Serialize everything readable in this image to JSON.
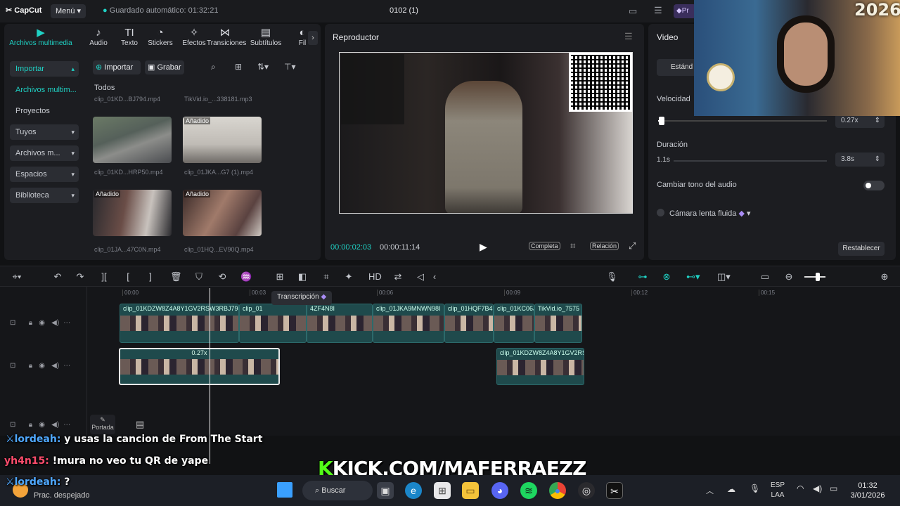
{
  "app": {
    "logo": "CapCut",
    "menu": "Menú",
    "autosave": "Guardado automático: 01:32:21",
    "project": "0102 (1)",
    "pro": "Pr"
  },
  "tabs": [
    {
      "label": "Archivos multimedia",
      "icon": "media-icon",
      "glyph": "▶"
    },
    {
      "label": "Audio",
      "icon": "audio-icon",
      "glyph": "♪"
    },
    {
      "label": "Texto",
      "icon": "text-icon",
      "glyph": "TI"
    },
    {
      "label": "Stickers",
      "icon": "sticker-icon",
      "glyph": "◔"
    },
    {
      "label": "Efectos",
      "icon": "effects-icon",
      "glyph": "✧"
    },
    {
      "label": "Transiciones",
      "icon": "transition-icon",
      "glyph": "⋈"
    },
    {
      "label": "Subtítulos",
      "icon": "subtitle-icon",
      "glyph": "▤"
    },
    {
      "label": "Fil",
      "icon": "filter-icon",
      "glyph": "◐"
    }
  ],
  "sidebar": [
    {
      "label": "Importar",
      "arrow": "▴"
    },
    {
      "label": "Archivos multim...",
      "arrow": ""
    },
    {
      "label": "Proyectos secun...",
      "arrow": ""
    },
    {
      "label": "Tuyos",
      "arrow": "▾"
    },
    {
      "label": "Archivos m...",
      "arrow": "▾"
    },
    {
      "label": "Espacios",
      "arrow": "▾"
    },
    {
      "label": "Biblioteca",
      "arrow": "▾"
    }
  ],
  "media": {
    "import": "Importar",
    "record": "Grabar",
    "all": "Todos",
    "top_files": [
      "clip_01KD...BJ794.mp4",
      "TikVid.io_...338181.mp3"
    ],
    "items": [
      {
        "badge": "",
        "name": "clip_01KD...HRP50.mp4"
      },
      {
        "badge": "Añadido",
        "name": "clip_01JKA...G7 (1).mp4"
      },
      {
        "badge": "Añadido",
        "name": "clip_01JA...47C0N.mp4"
      },
      {
        "badge": "Añadido",
        "name": "clip_01HQ...EV90Q.mp4"
      }
    ]
  },
  "player": {
    "title": "Reproductor",
    "current": "00:00:02:03",
    "total": "00:00:11:14",
    "full": "Completa",
    "ratio": "Relación"
  },
  "inspector": {
    "title": "Video",
    "standard": "Estánd",
    "speed_label": "Velocidad",
    "speed_value": "0.27x",
    "speed_fraction": 0.02,
    "duration_label": "Duración",
    "duration_min": "1.1s",
    "duration_value": "3.8s",
    "pitch_label": "Cambiar tono del audio",
    "smooth_label": "Cámara lenta fluida",
    "reset": "Restablecer"
  },
  "timeline": {
    "ticks": [
      "00:00",
      "00:03",
      "00:06",
      "00:09",
      "00:12",
      "00:15"
    ],
    "tooltip": "Transcripción",
    "cover_label": "Portada",
    "speed_badge": "0.27x",
    "main_clips": [
      "clip_01KDZW8Z4A8Y1GV2RSW3RBJ794.mp4",
      "00:",
      "clip_01",
      "4ZF4N8I",
      "clip_01JKA9MNWN98I",
      "clip_01HQF7B4Y",
      "clip_01KC06J",
      "TikVid.io_7575"
    ],
    "overlay_clip": "clip_01KDZW8Z4A8Y1GV2RS"
  },
  "chat": [
    {
      "user": "lordeah:",
      "msg": "y usas la cancion de From The Start",
      "color": "#4fa8ff"
    },
    {
      "user": "yh4n15:",
      "msg": "!mura no veo tu QR de yape",
      "color": "#ff4d6d"
    },
    {
      "user": "lordeah:",
      "msg": "?",
      "color": "#4fa8ff"
    }
  ],
  "kick": {
    "text": "KICK.COM/MAFERRAEZZ",
    "k": "K"
  },
  "taskbar": {
    "weather": "Prac. despejado",
    "search": "Buscar",
    "lang1": "ESP",
    "lang2": "LAA",
    "time": "01:32",
    "date": "3/01/2026"
  },
  "webcam": {
    "year": "2026"
  },
  "colors": {
    "accent": "#1fd1c4",
    "bg": "#111214",
    "panel": "#1c1d21",
    "kick": "#53fc18"
  }
}
